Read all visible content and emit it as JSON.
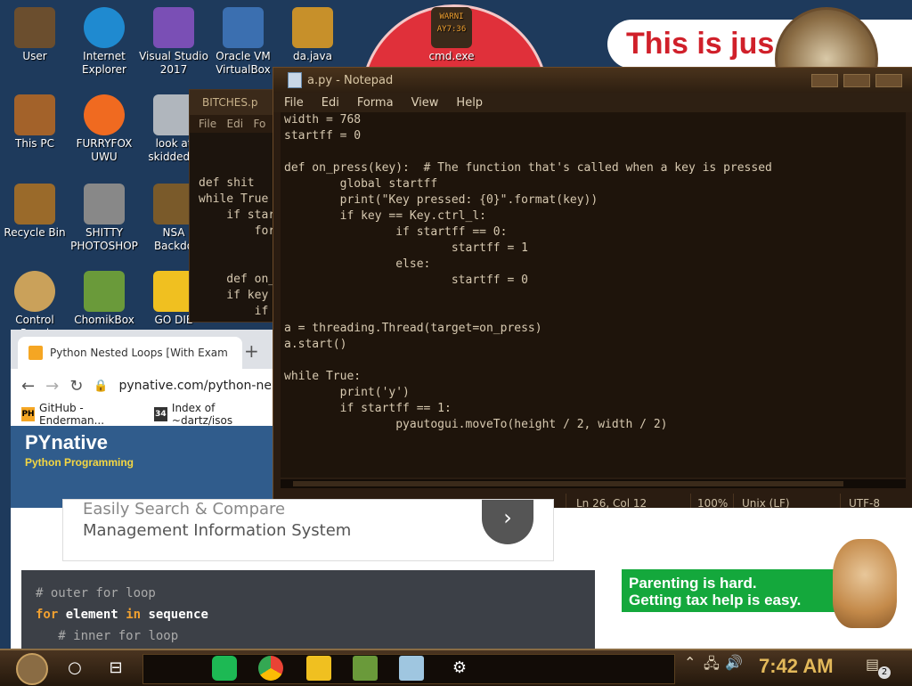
{
  "desktop_icons": [
    {
      "label": "User",
      "color": "#6b4e2e"
    },
    {
      "label": "Internet\nExplorer",
      "color": "#1f8ad0"
    },
    {
      "label": "Visual Studio\n2017",
      "color": "#7a4fb5"
    },
    {
      "label": "Oracle VM\nVirtualBox",
      "color": "#3b6fb0"
    },
    {
      "label": "da.java",
      "color": "#c7902a"
    },
    {
      "label": "cmd.exe",
      "color": "#3a2a1a"
    },
    {
      "label": "This PC",
      "color": "#a3622a"
    },
    {
      "label": "FURRYFOX\nUWU",
      "color": "#f06a20"
    },
    {
      "label": "look at\nskidded c",
      "color": "#b0b6bd"
    },
    {
      "label": "Recycle Bin",
      "color": "#9a6a2a"
    },
    {
      "label": "SHITTY\nPHOTOSHOP",
      "color": "#888888"
    },
    {
      "label": "NSA\nBackdo",
      "color": "#7a5a2a"
    },
    {
      "label": "Control Panel",
      "color": "#caa15a"
    },
    {
      "label": "ChomikBox",
      "color": "#6a9a3a"
    },
    {
      "label": "GO DIE",
      "color": "#f0c020"
    }
  ],
  "background": {
    "banner_text": "This is jus",
    "cmd_warning": "WARNI\nAY7:36"
  },
  "notepad_back": {
    "title": "BITCHES.p",
    "menu": [
      "File",
      "Edi",
      "Fo"
    ],
    "code": "\n\ndef shit\nwhile True\n    if star\n        for\n\n\n    def on_\n    if key\n        if"
  },
  "notepad": {
    "title": "a.py - Notepad",
    "menu": [
      "File",
      "Edi",
      "Forma",
      "View",
      "Help"
    ],
    "code": "width = 768\nstartff = 0\n\ndef on_press(key):  # The function that's called when a key is pressed\n        global startff\n        print(\"Key pressed: {0}\".format(key))\n        if key == Key.ctrl_l:\n                if startff == 0:\n                        startff = 1\n                else:\n                        startff = 0\n\n\na = threading.Thread(target=on_press)\na.start()\n\nwhile True:\n        print('y')\n        if startff == 1:\n                pyautogui.moveTo(height / 2, width / 2)",
    "status": {
      "position": "Ln 26, Col 12",
      "zoom": "100%",
      "line_ending": "Unix (LF)",
      "encoding": "UTF-8"
    }
  },
  "chrome": {
    "tab_title": "Python Nested Loops [With Exam",
    "new_tab": "+",
    "url": "pynative.com/python-ne",
    "bookmarks": [
      {
        "icon": "PH",
        "label": "GitHub - Enderman..."
      },
      {
        "icon": "34",
        "label": "Index of ~dartz/isos"
      }
    ],
    "site_title": "PYnative",
    "site_subtitle": "Python Programming"
  },
  "page": {
    "ad_line1": "Easily Search & Compare",
    "ad_line2": "Management Information System",
    "code_comment1": "# outer for loop",
    "code_kw_for": "for",
    "code_var": "element",
    "code_kw_in": "in",
    "code_seq": "sequence",
    "code_comment2": "# inner for loop",
    "tax_ad": "Parenting is hard.\nGetting tax help is easy."
  },
  "taskbar": {
    "time": "7:42 AM",
    "notification_count": "2"
  }
}
